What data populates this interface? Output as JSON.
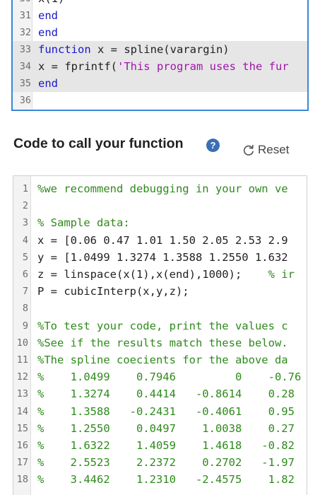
{
  "editor_top": {
    "lines": [
      {
        "n": "30",
        "segments": [
          {
            "t": "x(1)",
            "c": "plain"
          }
        ]
      },
      {
        "n": "31",
        "segments": [
          {
            "t": "end",
            "c": "kw"
          }
        ]
      },
      {
        "n": "32",
        "segments": [
          {
            "t": "end",
            "c": "kw"
          }
        ]
      },
      {
        "n": "33",
        "hl": true,
        "segments": [
          {
            "t": "function",
            "c": "kw"
          },
          {
            "t": " x = spline(varargin)",
            "c": "plain"
          }
        ]
      },
      {
        "n": "34",
        "hl": true,
        "segments": [
          {
            "t": "x = fprintf(",
            "c": "plain"
          },
          {
            "t": "'This program uses the fur",
            "c": "str"
          }
        ]
      },
      {
        "n": "35",
        "hl": true,
        "segments": [
          {
            "t": "end",
            "c": "kw"
          }
        ]
      },
      {
        "n": "36",
        "segments": []
      }
    ]
  },
  "section": {
    "title": "Code to call your function",
    "help_icon": "question-circle-icon",
    "help_glyph": "?",
    "reset_label": "Reset",
    "reset_icon": "refresh-icon"
  },
  "editor_bottom": {
    "lines": [
      {
        "n": "1",
        "segments": [
          {
            "t": "%we recommend debugging in your own ve",
            "c": "cm"
          }
        ]
      },
      {
        "n": "2",
        "segments": []
      },
      {
        "n": "3",
        "segments": [
          {
            "t": "% Sample data:",
            "c": "cm"
          }
        ]
      },
      {
        "n": "4",
        "segments": [
          {
            "t": "x = [0.06 0.47 1.01 1.50 2.05 2.53 2.9",
            "c": "plain"
          }
        ]
      },
      {
        "n": "5",
        "segments": [
          {
            "t": "y = [1.0499 1.3274 1.3588 1.2550 1.632",
            "c": "plain"
          }
        ]
      },
      {
        "n": "6",
        "segments": [
          {
            "t": "z = linspace(x(1),x(end),1000);    ",
            "c": "plain"
          },
          {
            "t": "% ir",
            "c": "cm"
          }
        ]
      },
      {
        "n": "7",
        "segments": [
          {
            "t": "P = cubicInterp(x,y,z);",
            "c": "plain"
          }
        ]
      },
      {
        "n": "8",
        "segments": []
      },
      {
        "n": "9",
        "segments": [
          {
            "t": "%To test your code, print the values c",
            "c": "cm"
          }
        ]
      },
      {
        "n": "10",
        "segments": [
          {
            "t": "%See if the results match these below.",
            "c": "cm"
          }
        ]
      },
      {
        "n": "11",
        "segments": [
          {
            "t": "%The spline coecients for the above da",
            "c": "cm"
          }
        ]
      },
      {
        "n": "12",
        "segments": [
          {
            "t": "%    1.0499    0.7946         0    -0.76",
            "c": "cm"
          }
        ]
      },
      {
        "n": "13",
        "segments": [
          {
            "t": "%    1.3274    0.4414   -0.8614    0.28",
            "c": "cm"
          }
        ]
      },
      {
        "n": "14",
        "segments": [
          {
            "t": "%    1.3588   -0.2431   -0.4061    0.95",
            "c": "cm"
          }
        ]
      },
      {
        "n": "15",
        "segments": [
          {
            "t": "%    1.2550    0.0497    1.0038    0.27",
            "c": "cm"
          }
        ]
      },
      {
        "n": "16",
        "segments": [
          {
            "t": "%    1.6322    1.4059    1.4618   -0.82",
            "c": "cm"
          }
        ]
      },
      {
        "n": "17",
        "segments": [
          {
            "t": "%    2.5523    2.2372    0.2702   -1.97",
            "c": "cm"
          }
        ]
      },
      {
        "n": "18",
        "segments": [
          {
            "t": "%    3.4462    1.2310   -2.4575    1.82",
            "c": "cm"
          }
        ]
      }
    ]
  },
  "colors": {
    "keyword": "#1a18c9",
    "string": "#a215ab",
    "comment": "#2e8a1c",
    "focus_border": "#3a87d6"
  }
}
